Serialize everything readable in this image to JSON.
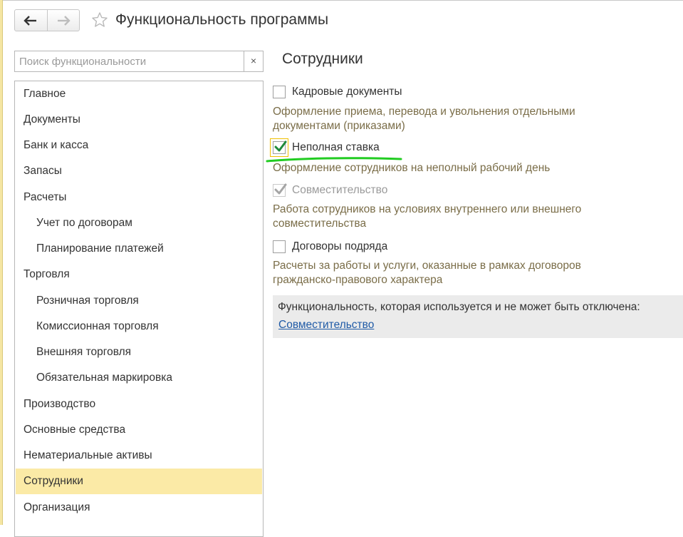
{
  "window": {
    "title": "Функциональность программы",
    "back_icon": "arrow-left-icon",
    "forward_icon": "arrow-right-icon",
    "favorite_icon": "star-icon"
  },
  "search": {
    "placeholder": "Поиск функциональности",
    "value": "",
    "clear_label": "×"
  },
  "sidebar": {
    "items": [
      {
        "label": "Главное",
        "level": 0
      },
      {
        "label": "Документы",
        "level": 0
      },
      {
        "label": "Банк и касса",
        "level": 0
      },
      {
        "label": "Запасы",
        "level": 0
      },
      {
        "label": "Расчеты",
        "level": 0
      },
      {
        "label": "Учет по договорам",
        "level": 1
      },
      {
        "label": "Планирование платежей",
        "level": 1
      },
      {
        "label": "Торговля",
        "level": 0
      },
      {
        "label": "Розничная торговля",
        "level": 1
      },
      {
        "label": "Комиссионная торговля",
        "level": 1
      },
      {
        "label": "Внешняя торговля",
        "level": 1
      },
      {
        "label": "Обязательная маркировка",
        "level": 1
      },
      {
        "label": "Производство",
        "level": 0
      },
      {
        "label": "Основные средства",
        "level": 0
      },
      {
        "label": "Нематериальные активы",
        "level": 0
      },
      {
        "label": "Сотрудники",
        "level": 0,
        "selected": true
      },
      {
        "label": "Организация",
        "level": 0
      }
    ]
  },
  "main": {
    "section_title": "Сотрудники",
    "options": [
      {
        "label": "Кадровые документы",
        "checked": false,
        "description": "Оформление приема, перевода и увольнения отдельными документами (приказами)"
      },
      {
        "label": "Неполная ставка",
        "checked": true,
        "focused": true,
        "description": "Оформление сотрудников на неполный рабочий день"
      },
      {
        "label": "Совместительство",
        "checked": true,
        "disabled": true,
        "description": "Работа сотрудников на условиях внутреннего или внешнего совместительства"
      },
      {
        "label": "Договоры подряда",
        "checked": false,
        "description": "Расчеты за работы и услуги, оказанные в рамках договоров гражданско-правового характера"
      }
    ],
    "info_panel": {
      "text": "Функциональность, которая используется и не может быть отключена:",
      "link": "Совместительство"
    }
  },
  "colors": {
    "selected_item": "#fbeaa6",
    "checkmark": "#1f8a3b",
    "annotation": "#22cc22",
    "description_text": "#7a6d48",
    "link": "#1f5aa6"
  }
}
